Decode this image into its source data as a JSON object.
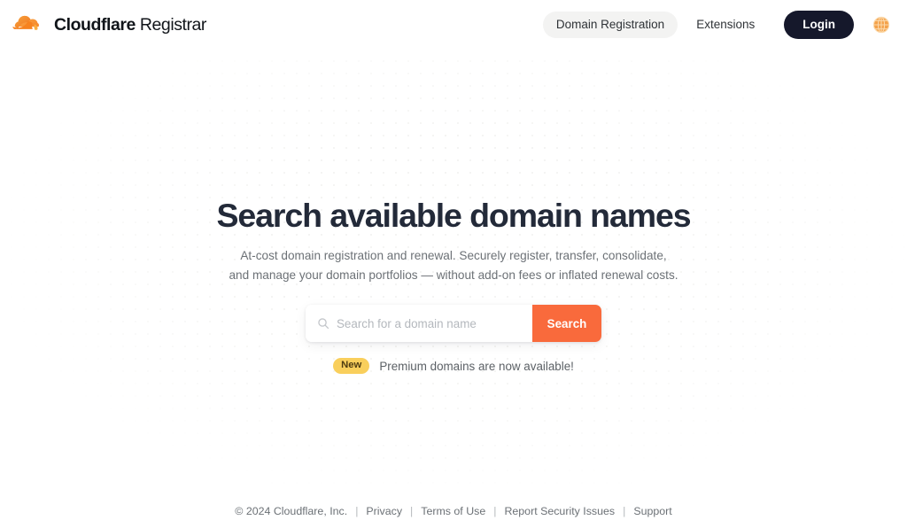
{
  "brand": {
    "logo_icon": "cloudflare-cloud-icon",
    "name_strong": "Cloudflare",
    "name_light": "Registrar"
  },
  "nav": {
    "items": [
      {
        "label": "Domain Registration",
        "active": true
      },
      {
        "label": "Extensions",
        "active": false
      }
    ],
    "login_label": "Login",
    "globe_icon": "globe-icon"
  },
  "hero": {
    "title": "Search available domain names",
    "subtitle_line1": "At-cost domain registration and renewal. Securely register, transfer, consolidate,",
    "subtitle_line2": "and manage your domain portfolios — without add-on fees or inflated renewal costs."
  },
  "search": {
    "icon": "search-icon",
    "placeholder": "Search for a domain name",
    "value": "",
    "button_label": "Search"
  },
  "promo": {
    "badge": "New",
    "text": "Premium domains are now available!"
  },
  "footer": {
    "copyright": "© 2024 Cloudflare, Inc.",
    "separator": "|",
    "links": [
      {
        "label": "Privacy"
      },
      {
        "label": "Terms of Use"
      },
      {
        "label": "Report Security Issues"
      },
      {
        "label": "Support"
      }
    ]
  },
  "colors": {
    "accent_orange": "#f96a3c",
    "logo_orange": "#f6821f",
    "dark_navy": "#15182b",
    "badge_yellow": "#f9cf5c",
    "title_ink": "#232a39",
    "muted_text": "#6c7176"
  }
}
